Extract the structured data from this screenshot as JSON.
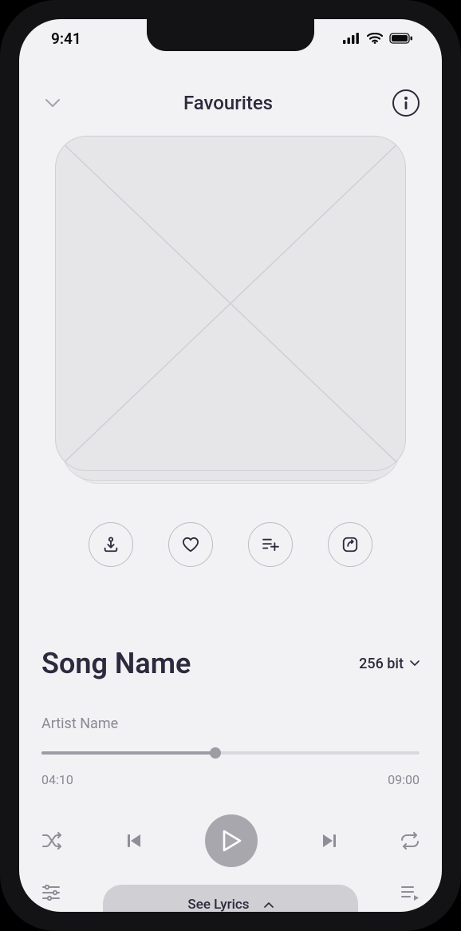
{
  "status": {
    "time": "9:41"
  },
  "header": {
    "title": "Favourites"
  },
  "song": {
    "name": "Song Name",
    "artist": "Artist Name",
    "bitrate_label": "256 bit",
    "elapsed": "04:10",
    "total": "09:00"
  },
  "lyrics": {
    "label": "See Lyrics"
  }
}
